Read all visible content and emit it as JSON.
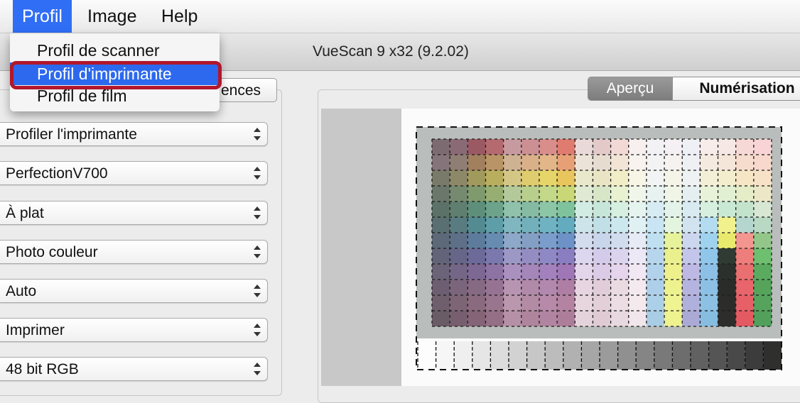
{
  "menubar": {
    "items": [
      {
        "label": "Profil",
        "active": true
      },
      {
        "label": "Image",
        "active": false
      },
      {
        "label": "Help",
        "active": false
      }
    ]
  },
  "window": {
    "title": "VueScan 9 x32 (9.2.02)"
  },
  "dropdown": {
    "items": [
      {
        "label": "Profil de scanner"
      },
      {
        "label": "Profil d'imprimante",
        "highlighted": true
      },
      {
        "label": "Profil de film"
      }
    ]
  },
  "left_panel": {
    "tab_label_visible": "ences",
    "selects": [
      {
        "value": "Profiler l'imprimante"
      },
      {
        "value": "PerfectionV700"
      },
      {
        "value": "À plat"
      },
      {
        "value": "Photo couleur"
      },
      {
        "value": "Auto"
      },
      {
        "value": "Imprimer"
      },
      {
        "value": "48 bit RGB"
      }
    ]
  },
  "right_panel": {
    "tabs": [
      {
        "label": "Aperçu",
        "selected": true
      },
      {
        "label": "Numérisation",
        "selected": false
      }
    ]
  },
  "colors": {
    "menu_active": "#2f6ef5",
    "highlight_ring": "#b2172b",
    "selected_tab": "#8a8a8a"
  },
  "target": {
    "cols": 19,
    "rows": 12,
    "palette": [
      [
        "#7d6b72",
        "#8a6a74",
        "#9b5a63",
        "#b46a6f",
        "#c79aa0",
        "#cc8f94",
        "#d98e8b",
        "#e07b70",
        "#e9d9d8",
        "#e3c9c8",
        "#f2d9d5",
        "#f8f0ef",
        "#f2f2f4",
        "#f4f0f4",
        "#eef0f5",
        "#f7ece9",
        "#f6e8e4",
        "#f6d8d6",
        "#f8d4d6"
      ],
      [
        "#85757a",
        "#8f7e73",
        "#a27f5d",
        "#b99466",
        "#cfb292",
        "#d9b088",
        "#e3b68a",
        "#e7a076",
        "#ece3d8",
        "#e7dcd0",
        "#f2e5d5",
        "#f8f3ee",
        "#f3f3f3",
        "#f6f2ef",
        "#eef0f4",
        "#f4eadf",
        "#f5e6da",
        "#f6dccc",
        "#f8d8cc"
      ],
      [
        "#7a7a6a",
        "#8c8868",
        "#a19a5d",
        "#b9ae5e",
        "#d4c785",
        "#decc6e",
        "#e6d569",
        "#e9c55e",
        "#eae8cc",
        "#e9e4c3",
        "#f1edc6",
        "#f7f6e6",
        "#f1f4f2",
        "#f5f4e8",
        "#eef2f2",
        "#f3efd6",
        "#f4edcd",
        "#f6e6c6",
        "#f7e2c8"
      ],
      [
        "#6a776a",
        "#758a6f",
        "#7f9a6d",
        "#96ae72",
        "#b3c99a",
        "#b8cf8c",
        "#c4d889",
        "#c9d776",
        "#dfe9d3",
        "#d8e6c8",
        "#e8f1d0",
        "#f1f6ea",
        "#e8f2f0",
        "#f0f5e8",
        "#e5eef0",
        "#e8f2d8",
        "#e1efd3",
        "#e4ecc8",
        "#ece8c7"
      ],
      [
        "#5c7268",
        "#5f7f70",
        "#5e8f7b",
        "#6ca38a",
        "#8fc1ab",
        "#86bba3",
        "#8cc6a6",
        "#7fc39c",
        "#d2ebe3",
        "#c7e6da",
        "#d6efe0",
        "#e6f4ef",
        "#d6ecf2",
        "#e4f3ea",
        "#d9eaf1",
        "#d6efdf",
        "#c9e9d4",
        "#c4e3cd",
        "#d7e7d4"
      ],
      [
        "#5a6f72",
        "#587c80",
        "#548b93",
        "#5e9ea8",
        "#7fb6c0",
        "#72b1bc",
        "#6fb3c3",
        "#63acbf",
        "#cde5ea",
        "#c0dfe6",
        "#cbe8ee",
        "#e0f1f4",
        "#c9e4f2",
        "#e3f5df",
        "#d1e3ef",
        "#b3dcf1",
        "#f1f28e",
        "#b4d6ce",
        "#b9d9c5"
      ],
      [
        "#5d6978",
        "#5d7088",
        "#5d7c9d",
        "#678cb2",
        "#8da8c8",
        "#849fc4",
        "#7b9dcc",
        "#6c92c7",
        "#d2dced",
        "#c8d5ea",
        "#d1dcef",
        "#e6ebf5",
        "#bfe0f0",
        "#e6f39a",
        "#ccd7ef",
        "#9fd2ee",
        "#e9ea6d",
        "#f39690",
        "#93c78a"
      ],
      [
        "#636479",
        "#666688",
        "#6c6a99",
        "#7a78ad",
        "#9b98c6",
        "#938dc1",
        "#8e89c5",
        "#8a7ec1",
        "#dcd6ee",
        "#d3cbe9",
        "#dcd4ef",
        "#ece8f6",
        "#b7d6ee",
        "#e9f08d",
        "#c3c6ea",
        "#8fc6ea",
        "#2f3b33",
        "#ee7e7b",
        "#6fbf70"
      ],
      [
        "#6b6377",
        "#746686",
        "#7d6893",
        "#8c73a4",
        "#aa90bf",
        "#a486b9",
        "#a381bd",
        "#9f76b6",
        "#e3d5ea",
        "#dccbe6",
        "#e5d4ec",
        "#f1e8f4",
        "#b2d2ec",
        "#eef08c",
        "#bdb9e4",
        "#8cc0e6",
        "#2b302c",
        "#ea6f70",
        "#5aaa5f"
      ],
      [
        "#6d5f71",
        "#7b657c",
        "#866983",
        "#977393",
        "#b794b1",
        "#b08aa8",
        "#b388ae",
        "#ae7ea4",
        "#e7d5e1",
        "#e1cdd9",
        "#eadbe3",
        "#f3e9ee",
        "#aecfe9",
        "#eef28e",
        "#b5b3df",
        "#8cc0e5",
        "#2a2c2a",
        "#e8656b",
        "#56a45c"
      ],
      [
        "#6f5f6c",
        "#7d6576",
        "#8a6a7e",
        "#9a758e",
        "#ba97ad",
        "#b48ba4",
        "#b78aa9",
        "#b383a1",
        "#e8d6df",
        "#e3cfd8",
        "#ebdde3",
        "#f4eaee",
        "#acd0e8",
        "#eff392",
        "#b0b0dc",
        "#8cc1e4",
        "#2c2c2b",
        "#e76068",
        "#55a35d"
      ],
      [
        "#6a5c66",
        "#775f6f",
        "#846476",
        "#946f86",
        "#b590a6",
        "#ae859d",
        "#b185a1",
        "#ad7e9a",
        "#e5d3dc",
        "#e0cbd5",
        "#e8d9e0",
        "#f1e6eb",
        "#a9cde5",
        "#eef28f",
        "#abaad7",
        "#87bde1",
        "#2d2e2c",
        "#e45a63",
        "#52a05b"
      ]
    ],
    "grayscale": [
      "#fdfdfd",
      "#f6f6f6",
      "#efefef",
      "#e6e6e6",
      "#dcdcdc",
      "#d2d2d2",
      "#c7c7c7",
      "#bcbcbc",
      "#b1b1b1",
      "#a6a6a6",
      "#9b9b9b",
      "#909090",
      "#858585",
      "#797979",
      "#6d6d6d",
      "#616161",
      "#555555",
      "#494949",
      "#3c3c3c",
      "#2f302e"
    ]
  }
}
